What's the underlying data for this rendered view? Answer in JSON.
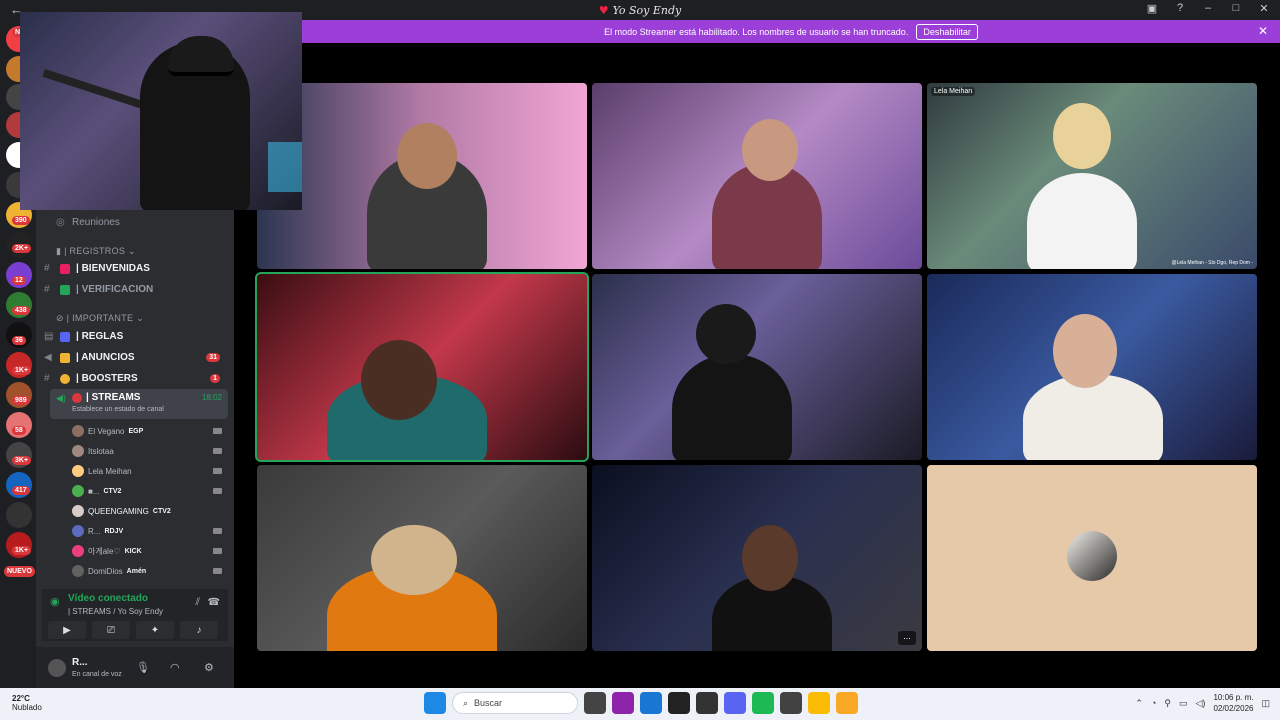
{
  "window": {
    "title": "Yo Soy Endy"
  },
  "streamer_bar": {
    "message": "El modo Streamer está habilitado. Los nombres de usuario se han truncado.",
    "button": "Deshabilitar"
  },
  "rail": {
    "badges": [
      "NU",
      "390",
      "2K+",
      "12",
      "438",
      "36",
      "1K+",
      "989",
      "58",
      "3K+",
      "417",
      "1K+"
    ],
    "nuevo": "NUEVO"
  },
  "sidebar": {
    "reuniones": "Reuniones",
    "categories": {
      "registros": "| REGISTROS",
      "importante": "| IMPORTANTE"
    },
    "channels": [
      {
        "label": "| BIENVENIDAS"
      },
      {
        "label": "| VERIFICACION"
      },
      {
        "label": "| REGLAS"
      },
      {
        "label": "| ANUNCIOS",
        "mention": "31"
      },
      {
        "label": "| BOOSTERS",
        "mention": "1"
      }
    ],
    "streams_channel": {
      "label": "| STREAMS",
      "time": "18:02",
      "sub": "Establece un estado de canal"
    },
    "voice_users": [
      {
        "name": "El Vegano",
        "tag": "EGP"
      },
      {
        "name": "Itslotaa",
        "tag": ""
      },
      {
        "name": "Lela Meihan",
        "tag": ""
      },
      {
        "name": "■...",
        "tag": "CTV2"
      },
      {
        "name": "QUEENGAMING",
        "tag": "CTV2"
      },
      {
        "name": "R...",
        "tag": "RDJV"
      },
      {
        "name": "아게ale♡",
        "tag": "KICK"
      },
      {
        "name": "DomiDios",
        "tag": "Amén"
      }
    ],
    "voice_panel": {
      "title": "Vídeo conectado",
      "sub": "| STREAMS / Yo Soy Endy"
    },
    "user_panel": {
      "name": "R...",
      "status": "En canal de voz"
    }
  },
  "stage": {
    "tile_name": "Lela Meihan",
    "tile_caption": "@Lela Meihan - Slo Dgo, Rep Dom -",
    "more": "..."
  },
  "taskbar": {
    "temp": "22°C",
    "weather": "Nublado",
    "search": "Buscar",
    "time": "10:06 p. m.",
    "date": "02/02/2026"
  },
  "colors": {
    "streamer_purple": "#9b3fd8",
    "mention_red": "#da373c",
    "online_green": "#23a55a"
  }
}
